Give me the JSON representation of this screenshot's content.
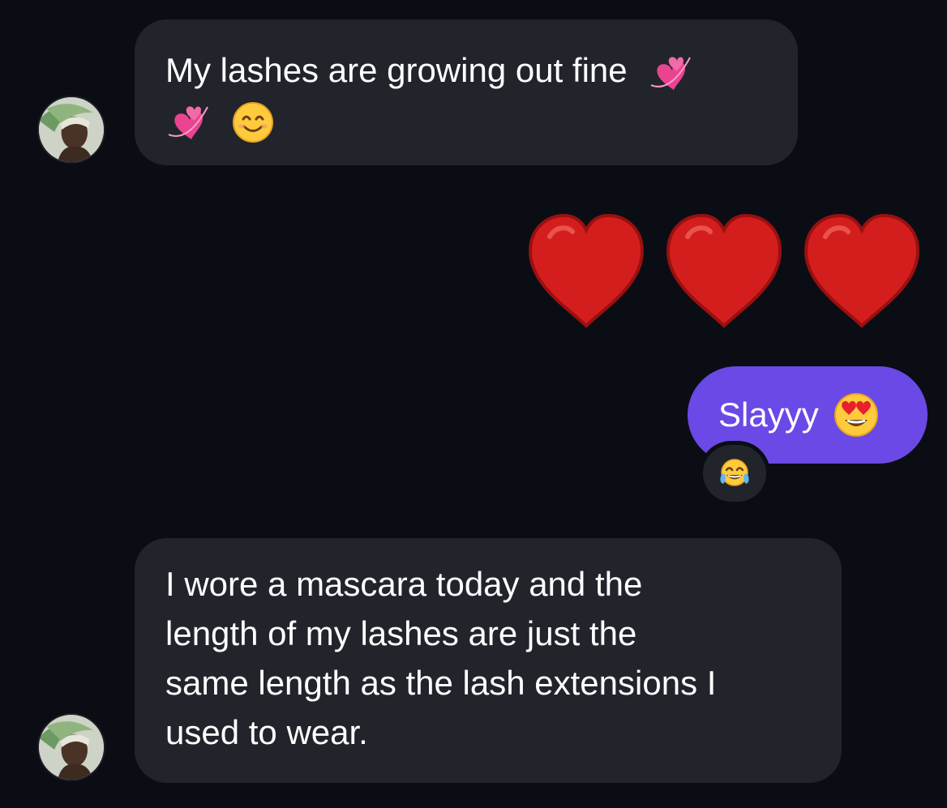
{
  "colors": {
    "background": "#0b0d14",
    "incoming_bubble": "#22242c",
    "outgoing_bubble": "#6a49e6",
    "text": "#ffffff",
    "heart": "#d41e1e"
  },
  "messages": [
    {
      "direction": "incoming",
      "lines": [
        "My lashes are growing out fine",
        ""
      ],
      "emojis": [
        "two-hearts-emoji",
        "two-hearts-emoji",
        "smiling-face-emoji"
      ],
      "avatar": "contact-avatar"
    },
    {
      "direction": "outgoing",
      "emojis": [
        "red-heart-emoji",
        "red-heart-emoji",
        "red-heart-emoji"
      ]
    },
    {
      "direction": "outgoing",
      "text": "Slayyy",
      "emojis": [
        "heart-eyes-emoji"
      ],
      "reaction": "tears-of-joy-emoji"
    },
    {
      "direction": "incoming",
      "lines": [
        "I wore a mascara today and the",
        "length of my lashes are just the",
        "same length as the lash extensions I",
        "used to wear."
      ],
      "avatar": "contact-avatar"
    }
  ]
}
